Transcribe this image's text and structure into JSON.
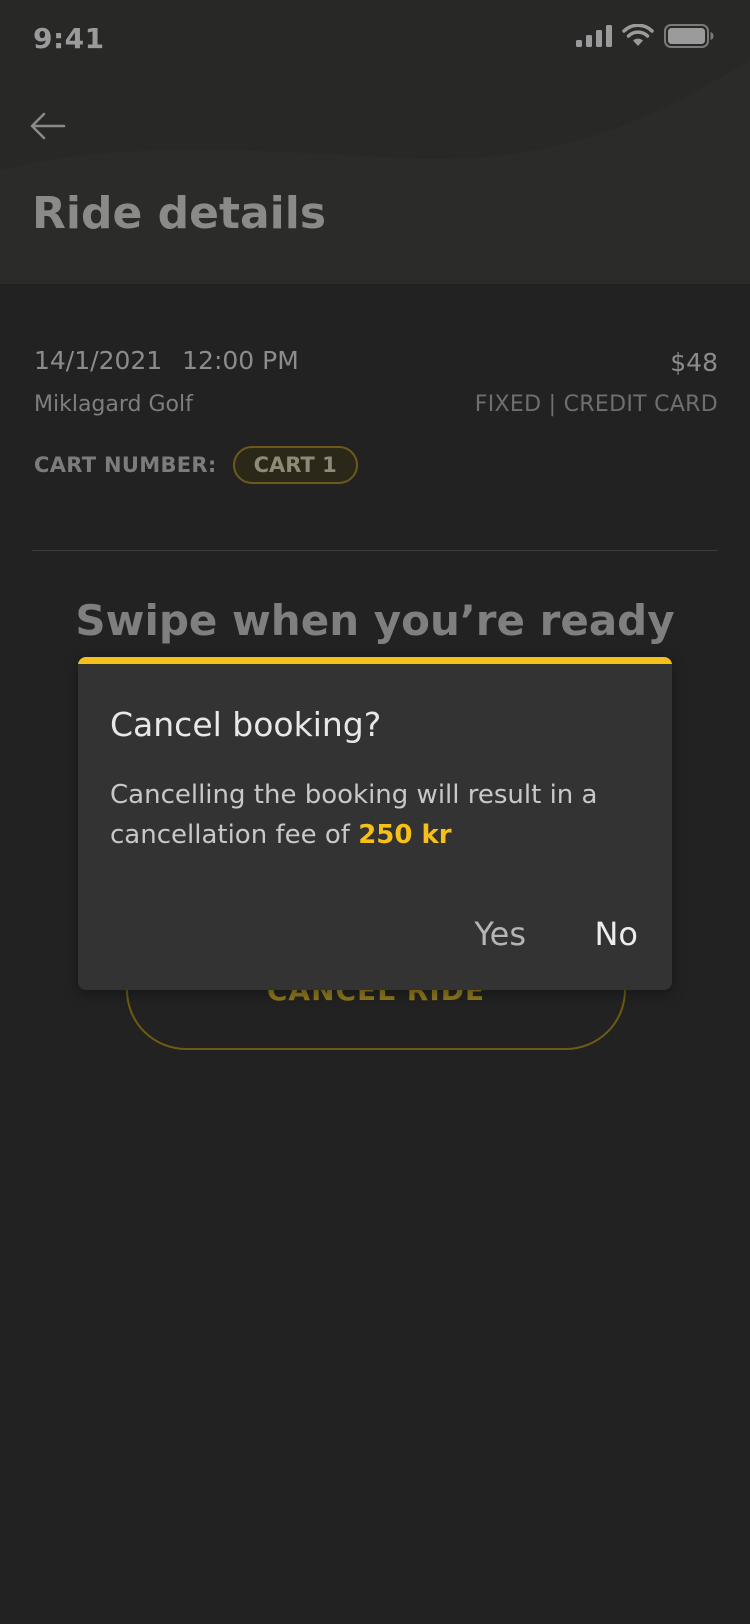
{
  "status_bar": {
    "time": "9:41",
    "icons": [
      "cellular-signal-icon",
      "wifi-icon",
      "battery-icon"
    ]
  },
  "header": {
    "back_icon": "arrow-left-icon",
    "title": "Ride details"
  },
  "booking": {
    "date": "14/1/2021",
    "time": "12:00 PM",
    "price": "$48",
    "location": "Miklagard Golf",
    "payment": "FIXED | CREDIT CARD",
    "cart_label": "CART NUMBER:",
    "cart_value": "CART 1"
  },
  "swipe_heading": "Swipe when you’re ready",
  "cancel_ride_label": "CANCEL RIDE",
  "dialog": {
    "title": "Cancel booking?",
    "message_prefix": "Cancelling the booking will result in a cancellation fee of ",
    "fee": "250 kr",
    "yes_label": "Yes",
    "no_label": "No"
  },
  "colors": {
    "background": "#222222",
    "accent": "#f5c01a",
    "dialog_background": "#333333"
  }
}
